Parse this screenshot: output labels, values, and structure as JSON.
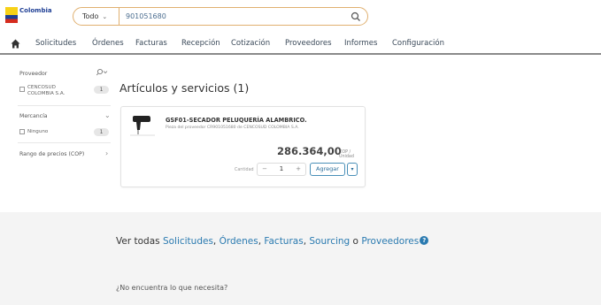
{
  "header": {
    "logo_text": "Colombia",
    "search": {
      "scope": "Todo",
      "value": "901051680"
    }
  },
  "nav": {
    "items": [
      {
        "label": "Solicitudes"
      },
      {
        "label": "Órdenes"
      },
      {
        "label": "Facturas"
      },
      {
        "label": "Recepción"
      },
      {
        "label": "Cotización"
      },
      {
        "label": "Proveedores"
      },
      {
        "label": "Informes"
      },
      {
        "label": "Configuración"
      }
    ]
  },
  "sidebar": {
    "supplier": {
      "label": "Proveedor",
      "option": "CENCOSUD COLOMBIA S.A.",
      "count": "1"
    },
    "merchandise": {
      "label": "Mercancía",
      "option": "Ninguno",
      "count": "1"
    },
    "price_range": {
      "label": "Rango de precios (COP)"
    }
  },
  "results": {
    "title": "Artículos y servicios (1)",
    "item": {
      "title": "GSF01-SECADOR PELUQUERÍA ALAMBRICO.",
      "supplier_line": "Pieza del proveedor CR901051680 de CENCOSUD COLOMBIA S.A.",
      "price": "286.364,00",
      "price_unit": "COP / Unidad",
      "quantity_label": "Cantidad",
      "quantity": "1",
      "minus": "−",
      "plus": "+",
      "add_label": "Agregar",
      "add_menu": "▾"
    }
  },
  "bottom": {
    "see_all_prefix": "Ver todas ",
    "links": [
      "Solicitudes",
      "Órdenes",
      "Facturas",
      "Sourcing",
      "Proveedores"
    ],
    "sep1": ", ",
    "sep2": ", ",
    "sep3": ", ",
    "sep4": " o ",
    "info": "?",
    "not_found": "¿No encuentra lo que necesita?"
  },
  "colors": {
    "accent": "#2a7ab0",
    "search_border": "#e0b070"
  }
}
